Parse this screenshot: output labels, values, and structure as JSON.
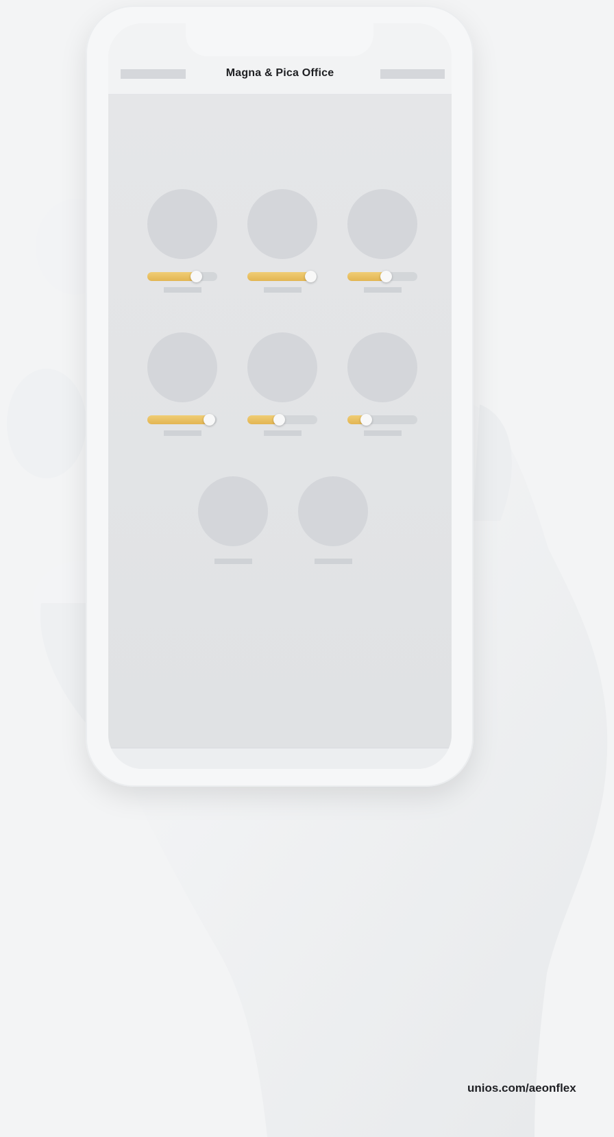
{
  "app": {
    "title": "Magna & Pica Office"
  },
  "devices": [
    {
      "level": 0.7
    },
    {
      "level": 0.9
    },
    {
      "level": 0.55
    },
    {
      "level": 0.88
    },
    {
      "level": 0.45
    },
    {
      "level": 0.26
    },
    {
      "level": null
    },
    {
      "level": null
    }
  ],
  "footer": {
    "url": "unios.com/aeonflex"
  },
  "colors": {
    "accent": "#e8bd5a",
    "placeholder": "#d4d6da",
    "screen": "#e3e5e7"
  }
}
